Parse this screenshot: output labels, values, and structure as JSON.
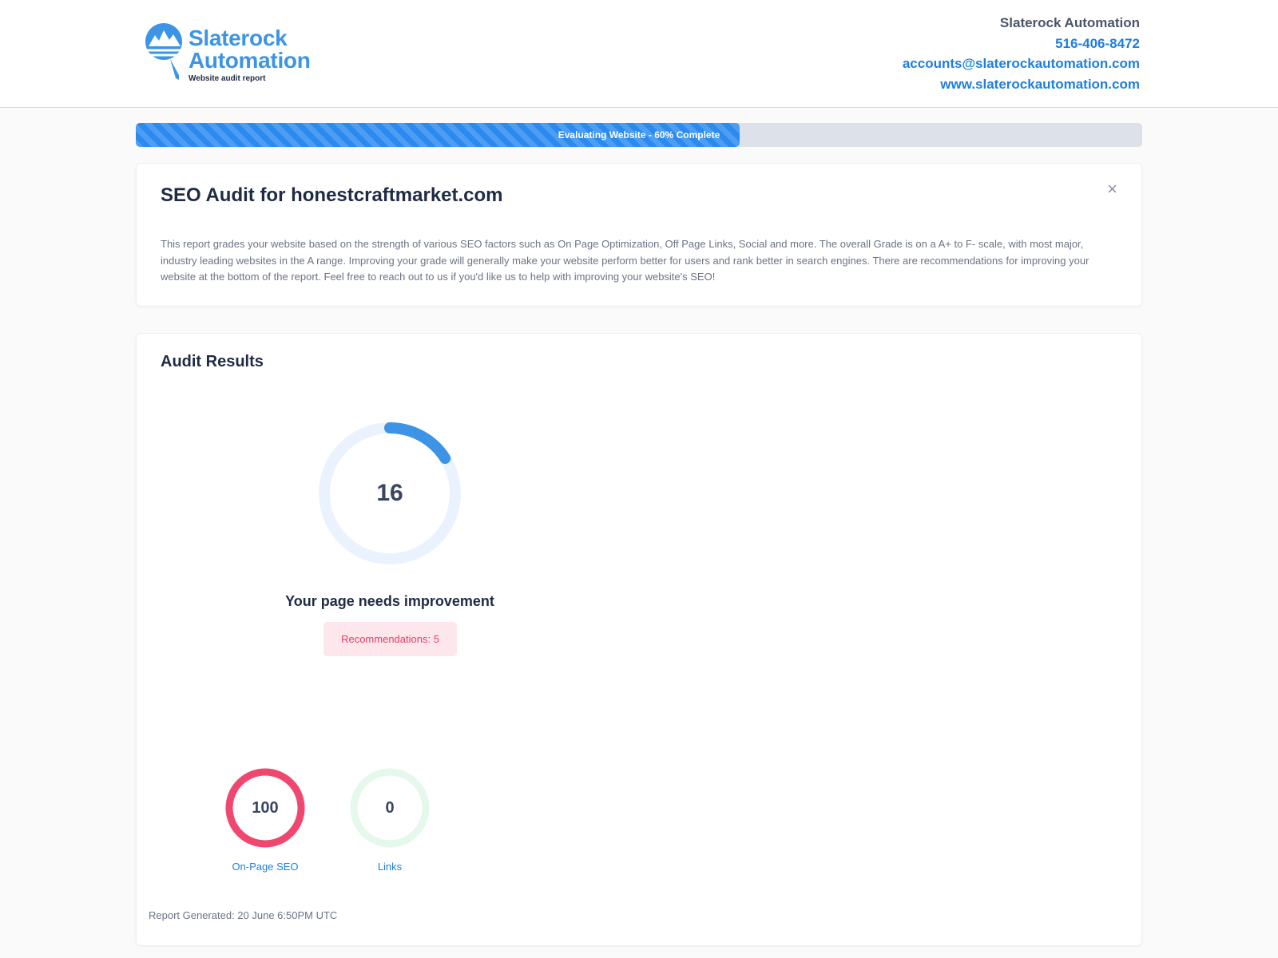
{
  "brand": {
    "logo_line1": "Slaterock",
    "logo_line2": "Automation",
    "logo_tagline": "Website audit report",
    "accent_color": "#3d94e6"
  },
  "contact": {
    "company": "Slaterock Automation",
    "phone": "516-406-8472",
    "email": "accounts@slaterockautomation.com",
    "website": "www.slaterockautomation.com"
  },
  "progress": {
    "label": "Evaluating Website - 60% Complete",
    "percent": 60,
    "color": "#2b8aef"
  },
  "intro": {
    "title": "SEO Audit for honestcraftmarket.com",
    "close_icon": "×",
    "description": "This report grades your website based on the strength of various SEO factors such as On Page Optimization, Off Page Links, Social and more. The overall Grade is on a A+ to F- scale, with most major, industry leading websites in the A range. Improving your grade will generally make your website perform better for users and rank better in search engines. There are recommendations for improving your website at the bottom of the report. Feel free to reach out to us if you'd like us to help with improving your website's SEO!"
  },
  "results": {
    "title": "Audit Results",
    "score": "16",
    "score_fraction": 0.16,
    "status": "Your page needs improvement",
    "recommendations": "Recommendations: 5",
    "metrics": [
      {
        "label": "On-Page SEO",
        "value": "100",
        "fraction": 1.0,
        "color": "#f0476e"
      },
      {
        "label": "Links",
        "value": "0",
        "fraction": 0.0,
        "color": "#22c55e"
      }
    ],
    "generated": "Report Generated: 20 June 6:50PM UTC"
  }
}
